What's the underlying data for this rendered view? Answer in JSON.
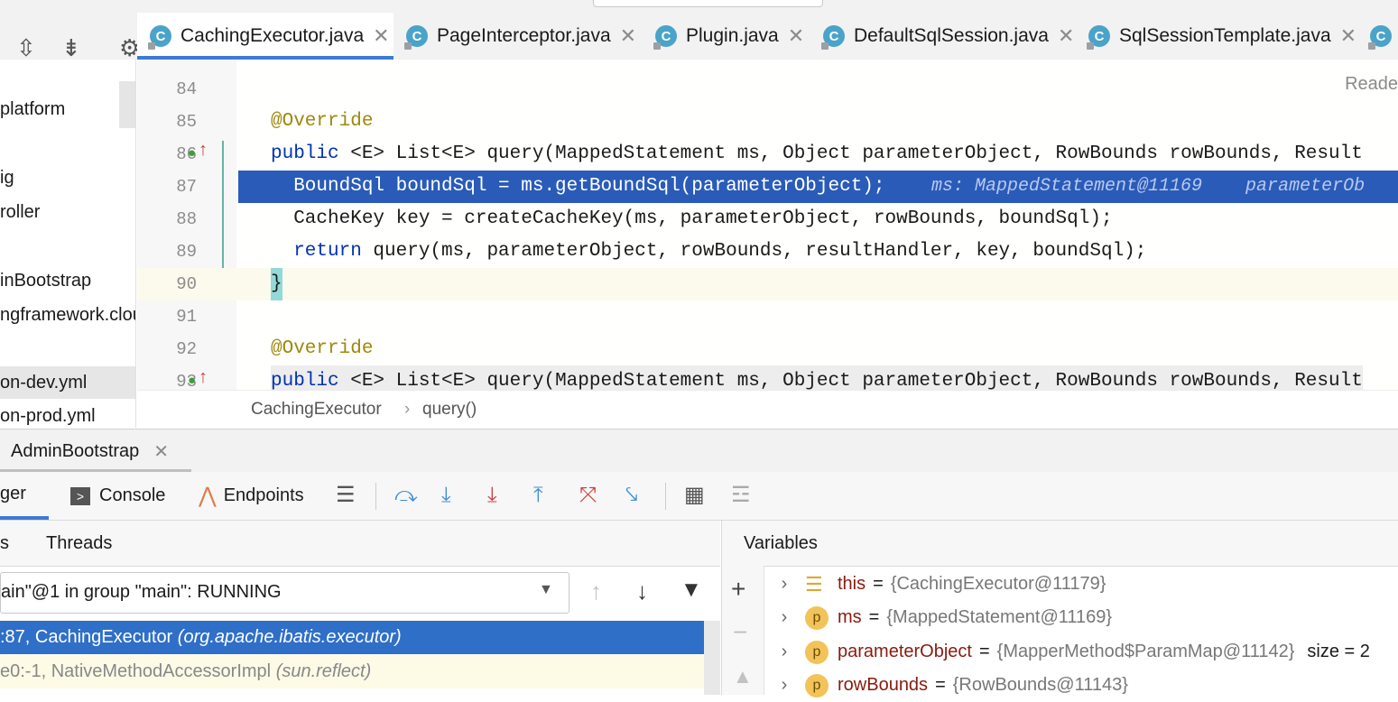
{
  "tabs": [
    {
      "label": "CachingExecutor.java",
      "active": true
    },
    {
      "label": "PageInterceptor.java",
      "active": false
    },
    {
      "label": "Plugin.java",
      "active": false
    },
    {
      "label": "DefaultSqlSession.java",
      "active": false
    },
    {
      "label": "SqlSessionTemplate.java",
      "active": false
    }
  ],
  "project_items": [
    "platform",
    "ig",
    "roller",
    "inBootstrap",
    "ngframework.clou",
    "on-dev.yml",
    "on-prod.yml"
  ],
  "editor": {
    "reader_mode": "Reade",
    "lines": [
      {
        "num": "84"
      },
      {
        "num": "85",
        "code": "@Override"
      },
      {
        "num": "86",
        "code_kw": "public",
        "code_rest": " <E> List<E> query(MappedStatement ms, Object parameterObject, RowBounds rowBounds, Result"
      },
      {
        "num": "87",
        "code": "  BoundSql boundSql = ms.getBoundSql(parameterObject);",
        "inlay": "ms: MappedStatement@11169    parameterOb"
      },
      {
        "num": "88",
        "code": "  CacheKey key = createCacheKey(ms, parameterObject, rowBounds, boundSql);"
      },
      {
        "num": "89",
        "code_kw": "  return",
        "code_rest": " query(ms, parameterObject, rowBounds, resultHandler, key, boundSql);"
      },
      {
        "num": "90",
        "code": "}"
      },
      {
        "num": "91"
      },
      {
        "num": "92",
        "code": "@Override"
      },
      {
        "num": "93",
        "code_kw": "public",
        "code_rest": " <E> List<E> query(MappedStatement ms, Object parameterObject, RowBounds rowBounds, Result"
      }
    ]
  },
  "breadcrumb": {
    "class": "CachingExecutor",
    "method": "query()"
  },
  "run_tab": "AdminBootstrap",
  "debug_tabs": {
    "debugger": "ger",
    "console": "Console",
    "endpoints": "Endpoints"
  },
  "frames_panel": {
    "tab_frames": "s",
    "tab_threads": "Threads",
    "thread": "ain\"@1 in group \"main\": RUNNING"
  },
  "frames": [
    {
      "loc": ":87, CachingExecutor ",
      "pkg": "(org.apache.ibatis.executor)",
      "selected": true
    },
    {
      "loc": "e0:-1, NativeMethodAccessorImpl ",
      "pkg": "(sun.reflect)",
      "selected": false
    }
  ],
  "variables_title": "Variables",
  "variables": [
    {
      "icon": "field-list-icon",
      "name": "this",
      "value": "{CachingExecutor@11179}",
      "extra": ""
    },
    {
      "icon": "p",
      "name": "ms",
      "value": "{MappedStatement@11169}",
      "extra": ""
    },
    {
      "icon": "p",
      "name": "parameterObject",
      "value": "{MapperMethod$ParamMap@11142}",
      "extra": "size = 2"
    },
    {
      "icon": "p",
      "name": "rowBounds",
      "value": "{RowBounds@11143}",
      "extra": ""
    }
  ]
}
